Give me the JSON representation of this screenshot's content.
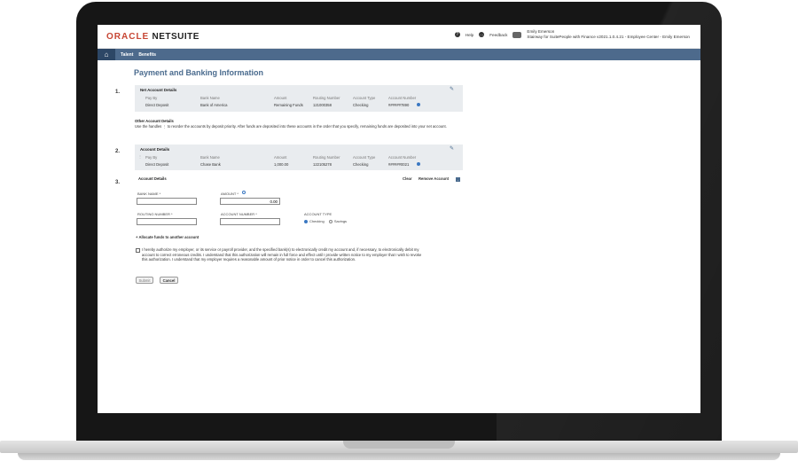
{
  "header": {
    "logo_oracle": "ORACLE",
    "logo_netsuite": "NETSUITE",
    "help": "Help",
    "feedback": "Feedback",
    "user_name": "Emily Emerson",
    "user_context": "Stairway for SuitePeople with Finance v2021.1.0.4.21 - Employee Center - Emily Emerson"
  },
  "nav": {
    "items": [
      "Talent",
      "Benefits"
    ]
  },
  "page": {
    "title": "Payment and Banking Information"
  },
  "net_account": {
    "step": "1.",
    "heading": "Net Account Details",
    "columns": [
      "Pay By",
      "Bank Name",
      "Amount",
      "Routing Number",
      "Account Type",
      "Account Number"
    ],
    "row": [
      "Direct Deposit",
      "Bank of America",
      "Remaining Funds",
      "121000358",
      "Checking",
      "######7890"
    ]
  },
  "other_account": {
    "heading": "Other Account Details",
    "text": "Use the handles ⋮ to reorder the accounts by deposit priority. After funds are deposited into these accounts in the order that you specify, remaining funds are deposited into your net account."
  },
  "account_2": {
    "step": "2.",
    "heading": "Account Details",
    "columns": [
      "Pay By",
      "Bank Name",
      "Amount",
      "Routing Number",
      "Account Type",
      "Account Number"
    ],
    "row": [
      "Direct Deposit",
      "Chase Bank",
      "1,000.00",
      "122105278",
      "Checking",
      "######0021"
    ]
  },
  "account_3": {
    "step": "3.",
    "heading": "Account Details",
    "clear": "Clear",
    "remove": "Remove Account",
    "bank_name_label": "BANK NAME *",
    "amount_label": "AMOUNT *",
    "amount_value": "0.00",
    "routing_label": "ROUTING NUMBER *",
    "account_number_label": "ACCOUNT NUMBER *",
    "account_type_label": "ACCOUNT TYPE",
    "checking": "Checking",
    "savings": "Savings",
    "allocate": "Allocate funds to another account"
  },
  "authorization": {
    "text": "I hereby authorize my employer, or its service or payroll provider, and the specified bank(s) to electronically credit my account and, if necessary, to electronically debit my account to correct erroneous credits. I understand that this authorization will remain in full force and effect until I provide written notice to my employer that I wish to revoke this authorization. I understand that my employer requires a reasonable amount of prior notice in order to cancel this authorization."
  },
  "actions": {
    "submit": "Submit",
    "cancel": "Cancel"
  }
}
